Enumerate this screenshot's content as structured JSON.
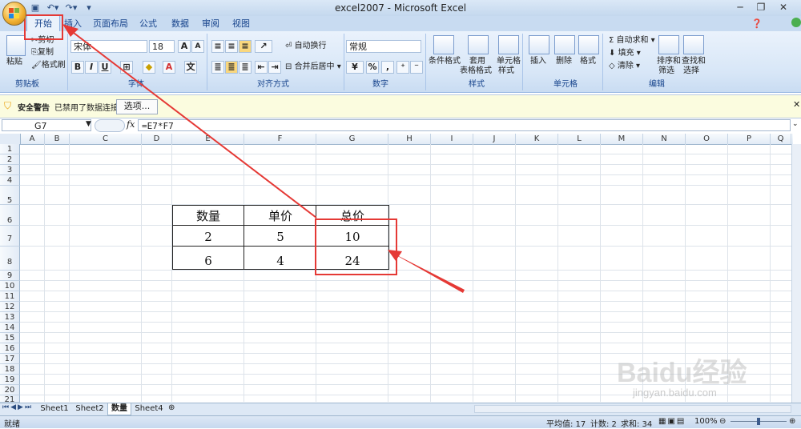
{
  "window": {
    "title": "excel2007 - Microsoft Excel",
    "minimize": "─",
    "restore": "❐",
    "close": "✕"
  },
  "tabs": [
    "开始",
    "插入",
    "页面布局",
    "公式",
    "数据",
    "审阅",
    "视图"
  ],
  "ribbon": {
    "clipboard": {
      "paste": "粘贴",
      "cut": "剪切",
      "copy": "复制",
      "format_painter": "格式刷",
      "label": "剪贴板"
    },
    "font": {
      "name": "宋体",
      "size": "18",
      "label": "字体",
      "bold": "B",
      "italic": "I",
      "underline": "U"
    },
    "alignment": {
      "wrap": "自动换行",
      "merge": "合并后居中",
      "label": "对齐方式"
    },
    "number": {
      "format": "常规",
      "label": "数字",
      "percent": "%",
      "comma": ","
    },
    "styles": {
      "conditional": "条件格式",
      "table1": "套用",
      "table2": "表格格式",
      "cell1": "单元格",
      "cell2": "样式",
      "label": "样式"
    },
    "cells": {
      "insert": "插入",
      "delete": "删除",
      "format": "格式",
      "label": "单元格"
    },
    "editing": {
      "autosum": "自动求和",
      "fill": "填充",
      "clear": "清除",
      "sort1": "排序和",
      "sort2": "筛选",
      "find1": "查找和",
      "find2": "选择",
      "label": "编辑"
    }
  },
  "security": {
    "title": "安全警告",
    "message": "已禁用了数据连接",
    "options": "选项..."
  },
  "formula_bar": {
    "name_box": "G7",
    "fx": "fx",
    "formula": "=E7*F7"
  },
  "columns": [
    "A",
    "B",
    "C",
    "D",
    "E",
    "F",
    "G",
    "H",
    "I",
    "J",
    "K",
    "L",
    "M",
    "N",
    "O",
    "P",
    "Q"
  ],
  "rows": [
    "1",
    "2",
    "3",
    "4",
    "5",
    "6",
    "7",
    "8",
    "9",
    "10",
    "11",
    "12",
    "13",
    "14",
    "15",
    "16",
    "17",
    "18",
    "19",
    "20",
    "21"
  ],
  "table": {
    "headers": [
      "数量",
      "单价",
      "总价"
    ],
    "row7": [
      "2",
      "5",
      "10"
    ],
    "row8": [
      "6",
      "4",
      "24"
    ]
  },
  "sheets": [
    "Sheet1",
    "Sheet2",
    "数量",
    "Sheet4"
  ],
  "status": {
    "ready": "就绪",
    "average": "平均值: 17",
    "count": "计数: 2",
    "sum": "求和: 34",
    "zoom": "100%"
  },
  "watermark": {
    "brand": "Baidu经验",
    "url": "jingyan.baidu.com"
  },
  "colors": {
    "annotation": "#e53935",
    "ribbon": "#d7e6f7",
    "accent": "#15428b"
  }
}
